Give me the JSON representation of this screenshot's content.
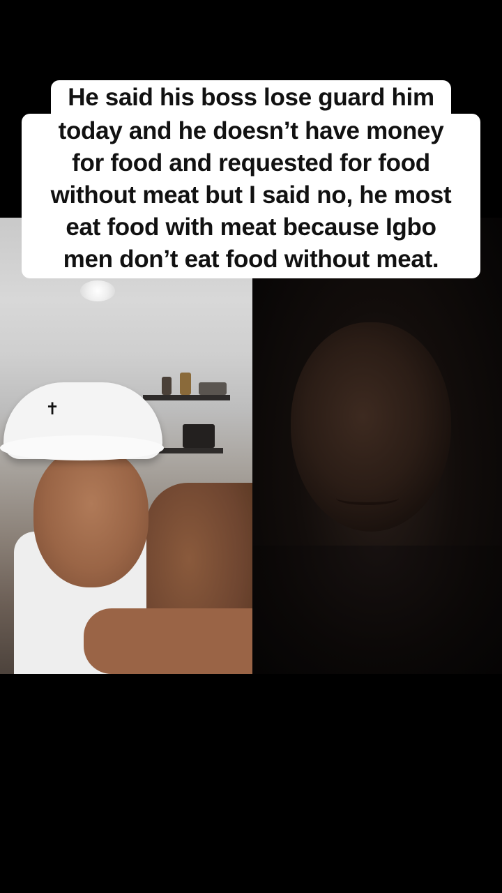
{
  "caption": {
    "lines": [
      "He said his boss lose guard him",
      "today and he doesn’t have money",
      "for food and requested for food",
      "without meat but I said no, he most",
      "eat food with meat because Igbo",
      "men don’t eat food without meat."
    ]
  },
  "video": {
    "left_cap_logo_icon": "cross-logo-icon",
    "colors": {
      "background": "#000000",
      "caption_box": "#ffffff",
      "caption_text": "#111111"
    }
  }
}
